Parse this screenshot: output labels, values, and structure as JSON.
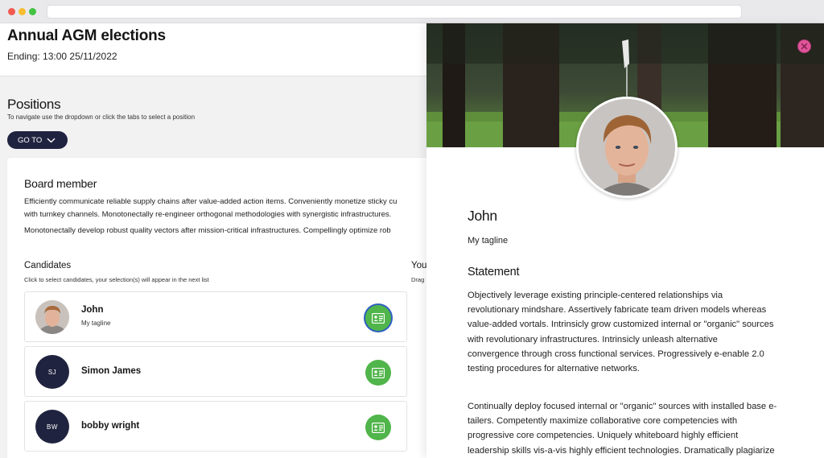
{
  "app": {
    "title": "Annual AGM elections",
    "ending": "Ending: 13:00 25/11/2022"
  },
  "positions": {
    "title": "Positions",
    "hint": "To navigate use the dropdown or click the tabs to select a position",
    "goto_label": "GO TO"
  },
  "position": {
    "title": "Board member",
    "desc_line1": "Efficiently communicate reliable supply chains after value-added action items. Conveniently monetize sticky cu",
    "desc_line2": "with turnkey channels. Monotonectally re-engineer orthogonal methodologies with synergistic infrastructures.",
    "desc_line3": "Monotonectally develop robust quality vectors after mission-critical infrastructures. Compellingly optimize rob"
  },
  "candidates": {
    "title": "Candidates",
    "hint": "Click to select candidates, your selection(s) will appear in the next list",
    "items": [
      {
        "name": "John",
        "tagline": "My tagline",
        "initials": ""
      },
      {
        "name": "Simon James",
        "tagline": "",
        "initials": "SJ"
      },
      {
        "name": "bobby wright",
        "tagline": "",
        "initials": "BW"
      }
    ]
  },
  "selection": {
    "title": "You",
    "hint": "Drag"
  },
  "profile": {
    "name": "John",
    "tagline": "My tagline",
    "statement_title": "Statement",
    "para1_line1": "Objectively leverage existing principle-centered relationships via",
    "para1_line2": "revolutionary mindshare. Assertively fabricate team driven models whereas",
    "para1_line3": "value-added vortals. Intrinsicly grow customized internal or \"organic\" sources",
    "para1_line4": "with revolutionary infrastructures. Intrinsicly unleash alternative",
    "para1_line5": "convergence through cross functional services. Progressively e-enable 2.0",
    "para1_line6": "testing procedures for alternative networks.",
    "para2_line1": "Continually deploy focused internal or \"organic\" sources with installed base e-",
    "para2_line2": "tailers. Competently maximize collaborative core competencies with",
    "para2_line3": "progressive core competencies. Uniquely whiteboard highly efficient",
    "para2_line4": "leadership skills vis-a-vis highly efficient technologies. Dramatically plagiarize"
  },
  "colors": {
    "navy": "#20233f",
    "green": "#50b54a",
    "close_pink": "#e0559a"
  },
  "icons": {
    "goto": "chevron-down-icon",
    "profile": "id-card-icon",
    "close": "close-icon"
  }
}
